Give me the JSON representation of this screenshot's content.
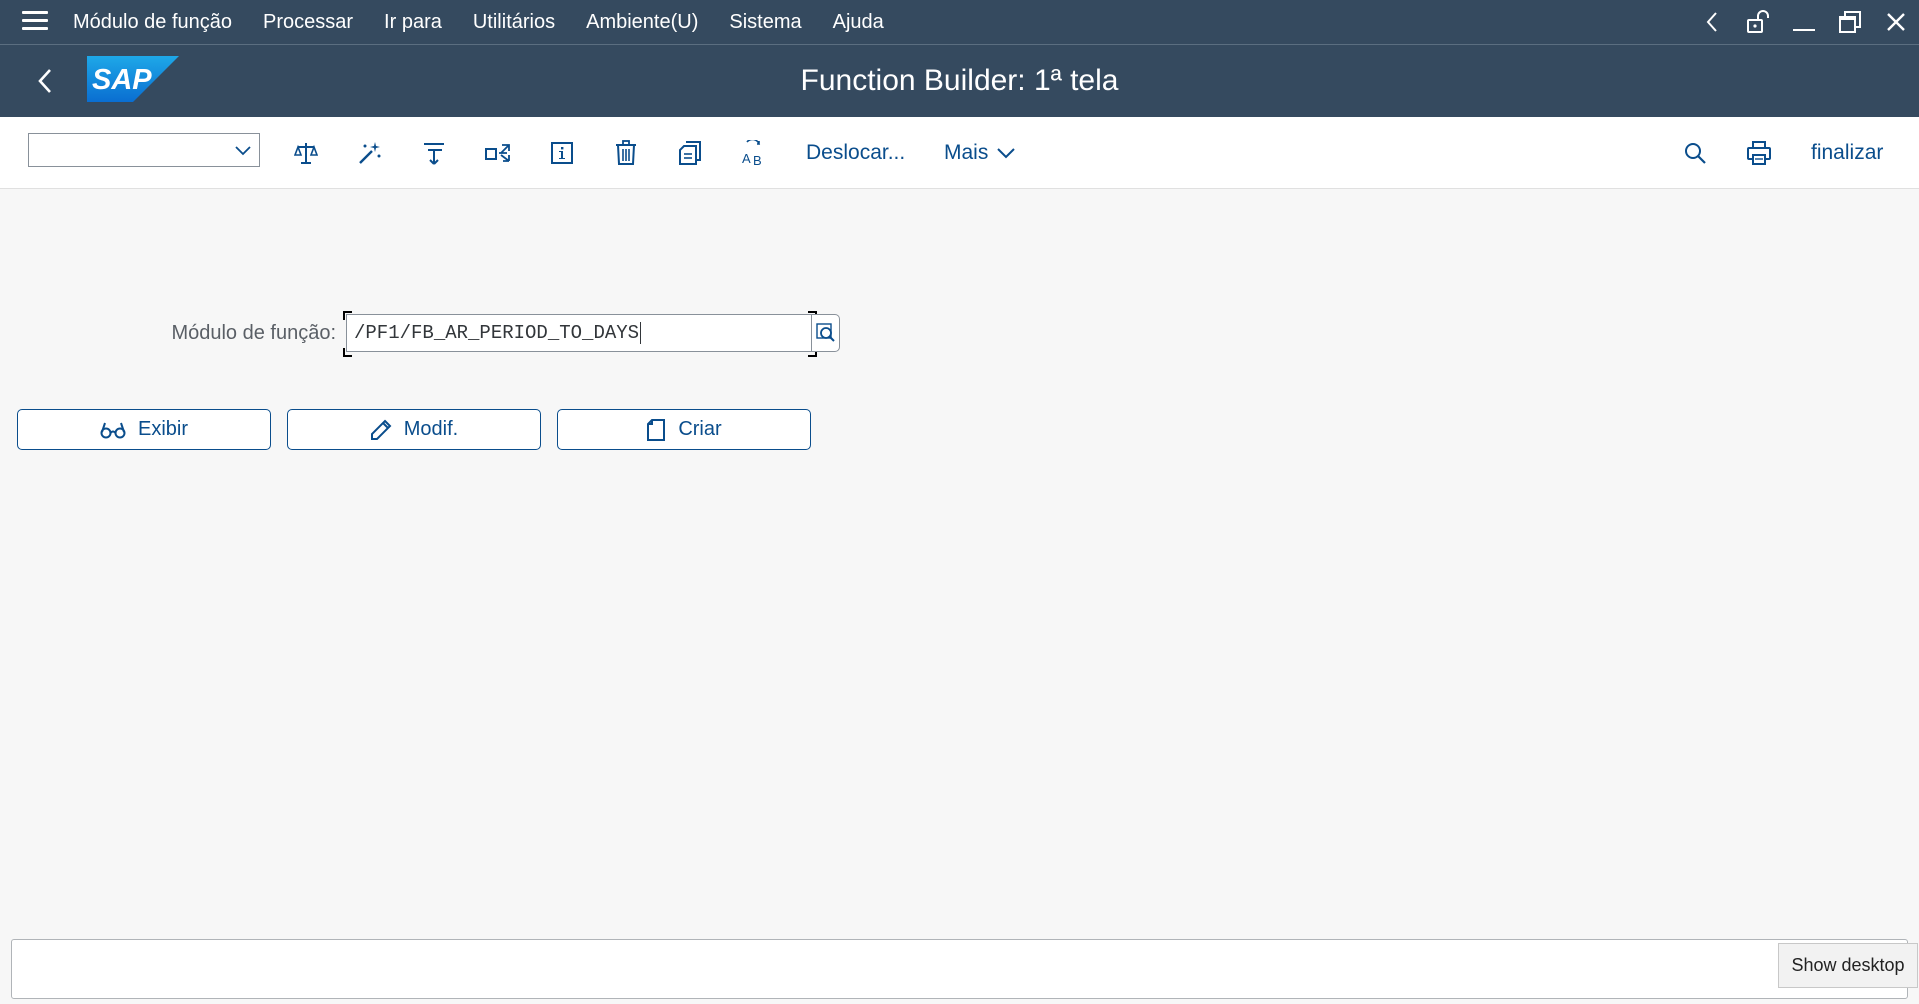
{
  "menubar": {
    "items": [
      {
        "label": "Módulo de função"
      },
      {
        "label": "Processar"
      },
      {
        "label": "Ir para"
      },
      {
        "label": "Utilitários"
      },
      {
        "label": "Ambiente(U)"
      },
      {
        "label": "Sistema"
      },
      {
        "label": "Ajuda"
      }
    ],
    "window_controls": [
      "chevron-left-icon",
      "unlock-icon",
      "minimize-icon",
      "restore-icon",
      "close-icon"
    ]
  },
  "titlebar": {
    "logo_text": "SAP",
    "title": "Function Builder: 1ª tela"
  },
  "toolbar": {
    "command_field_value": "",
    "icons": [
      "compare-icon",
      "magic-wand-icon",
      "where-used-icon",
      "display-object-list-icon",
      "info-icon",
      "delete-icon",
      "copy-icon",
      "rename-icon"
    ],
    "move_label": "Deslocar...",
    "more_label": "Mais",
    "exit_label": "finalizar"
  },
  "form": {
    "function_module_label": "Módulo de função:",
    "function_module_value": "/PF1/FB_AR_PERIOD_TO_DAYS"
  },
  "buttons": {
    "display_label": "Exibir",
    "change_label": "Modif.",
    "create_label": "Criar"
  },
  "statusbar": {
    "message": ""
  },
  "taskbar": {
    "show_desktop_tooltip": "Show desktop"
  },
  "colors": {
    "shell": "#354a5f",
    "accent": "#0a4d8c",
    "background": "#f7f7f7"
  }
}
